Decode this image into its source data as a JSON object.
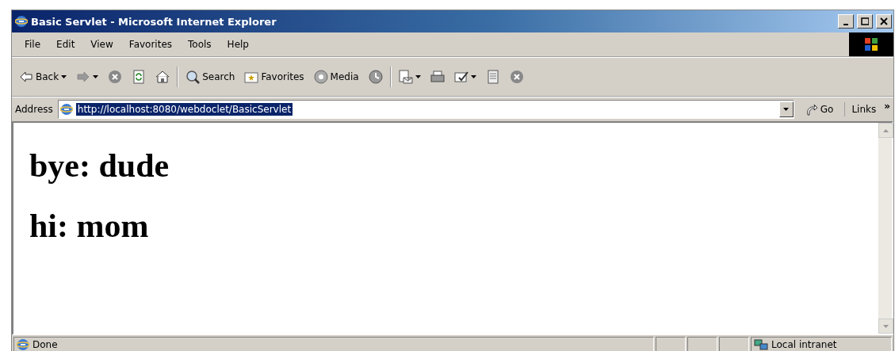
{
  "window": {
    "title": "Basic Servlet - Microsoft Internet Explorer"
  },
  "menu": [
    "File",
    "Edit",
    "View",
    "Favorites",
    "Tools",
    "Help"
  ],
  "toolbar": [
    {
      "kind": "back",
      "label": "Back"
    },
    {
      "kind": "forward"
    },
    {
      "kind": "stop"
    },
    {
      "kind": "refresh"
    },
    {
      "kind": "home"
    },
    {
      "kind": "separator"
    },
    {
      "kind": "search",
      "label": "Search"
    },
    {
      "kind": "favorites",
      "label": "Favorites"
    },
    {
      "kind": "media",
      "label": "Media"
    },
    {
      "kind": "history"
    },
    {
      "kind": "separator"
    },
    {
      "kind": "mail"
    },
    {
      "kind": "print"
    },
    {
      "kind": "edit"
    },
    {
      "kind": "discuss"
    },
    {
      "kind": "messenger"
    }
  ],
  "address_bar": {
    "label": "Address",
    "value": "http://localhost:8080/webdoclet/BasicServlet",
    "selected": true,
    "go": "Go",
    "links": "Links",
    "more": "»"
  },
  "content": {
    "headings": [
      "bye: dude",
      "hi: mom"
    ]
  },
  "status_bar": {
    "text": "Done",
    "zone": "Local intranet"
  }
}
